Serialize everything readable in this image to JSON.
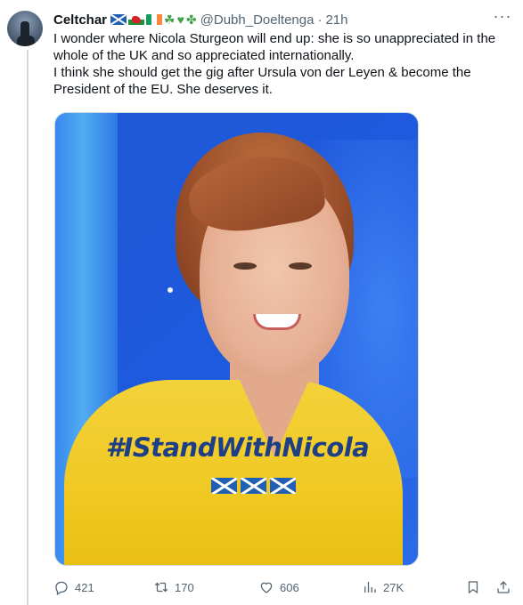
{
  "tweet": {
    "author_name": "Celtchar",
    "author_emojis": [
      "scotland-flag",
      "wales-flag",
      "ireland-flag",
      "shamrock",
      "green-heart",
      "four-leaf-clover"
    ],
    "handle": "@Dubh_Doeltenga",
    "separator": "·",
    "time": "21h",
    "more_label": "···",
    "text_line_1": "I wonder where Nicola Sturgeon will end up: she is so unappreciated in the whole of the UK and so appreciated internationally.",
    "text_line_2": "I think she should get the gig after Ursula von der Leyen & become the President of the EU. She deserves it."
  },
  "media": {
    "overlay_text": "#IStandWithNicola",
    "overlay_flags": 3
  },
  "actions": {
    "replies": "421",
    "retweets": "170",
    "likes": "606",
    "views": "27K"
  },
  "colors": {
    "text": "#0f1419",
    "secondary": "#536471",
    "divider": "#cfd9de",
    "saltire_blue": "#1f5fb4",
    "jacket_yellow": "#efc71f"
  }
}
